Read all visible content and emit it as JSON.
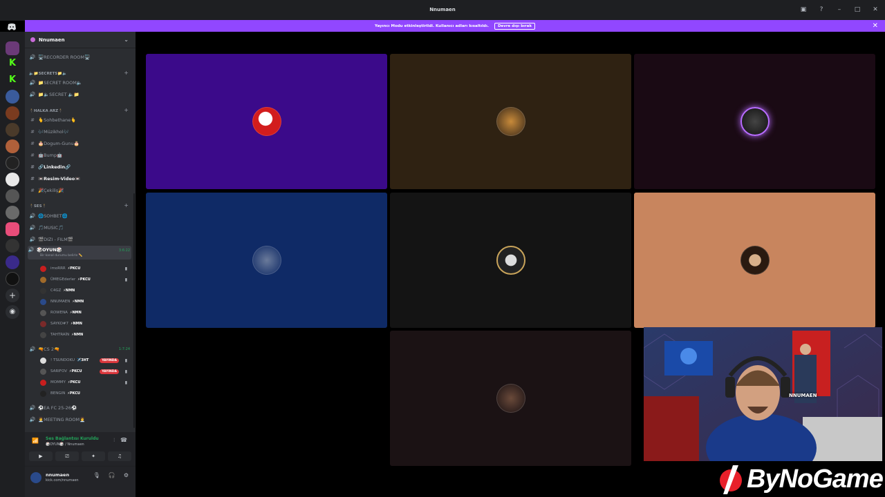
{
  "window": {
    "title": "Nnumaen"
  },
  "banner": {
    "text": "Yayıncı Modu etkinleştirildi. Kullanıcı adları kısaltıldı.",
    "button": "Devre dışı bırak"
  },
  "server": {
    "name": "Nnumaen"
  },
  "channels": {
    "recorder": "🖥️RECORDER ROOM🖥️",
    "cat_secrets": "🔈📁SECRETS📁🔈",
    "secret_room": "📁SECRET ROOM🔈",
    "secret": "📁🔈SECRET 🔈📁",
    "cat_halka": "🕴️HALKA ARZ🕴️",
    "sohbethane": "🫰Sohbethane🫰",
    "muzikhol": "🎶Müzikhol🎶",
    "dogum": "🎂Dogum-Gunu🎂",
    "bump": "🤖Bump🤖",
    "linkedin": "🔗Linkedin🔗",
    "resim": "📼Resim-Video📼",
    "cekilis": "🎉Çekiliş🎉",
    "cat_ses": "🕴️SES🕴️",
    "sohbet": "🌐SOHBET🌐",
    "music": "🎵MUSIC🎵",
    "dizi": "🎬DIZI - FILM🎬",
    "oyun": "🎲OYUN🎲",
    "oyun_timer": "3:6:22",
    "oyun_sub": "Bir kanal durumu belirle ✏️",
    "cs2": "🔫CS 2🔫",
    "cs2_timer": "1:7:24",
    "eafc": "⚽EA FC 25-26⚽",
    "meeting": "👩‍💼MEETING ROOM👩‍💼"
  },
  "oyun_users": [
    {
      "name": "imoRRR",
      "tag": "⚡PKCU"
    },
    {
      "name": "ÜMEGEderler",
      "tag": "⚡PKCU"
    },
    {
      "name": "C4GZ",
      "tag": "⚡NMN"
    },
    {
      "name": "NNUMAEN",
      "tag": "⚡NMN"
    },
    {
      "name": "ROWENA",
      "tag": "⚡NMN"
    },
    {
      "name": "SAYKO#7",
      "tag": "⚡NMN"
    },
    {
      "name": "TAHTRAİN",
      "tag": "⚡NMN"
    }
  ],
  "cs2_users": [
    {
      "name": "! TSUNDOKU",
      "tag": "✈️3HT",
      "live": "YAYINDA"
    },
    {
      "name": "SARIFOV",
      "tag": "⚡PKCU",
      "live": "YAYINDA"
    },
    {
      "name": "MOMMY",
      "tag": "⚡PKCU"
    },
    {
      "name": "BENGIN",
      "tag": "⚡PKCU"
    }
  ],
  "voice": {
    "status": "Ses Bağlantısı Kuruldu",
    "channel": "🎲OYUN🎲 / Nnumaen"
  },
  "user": {
    "name": "nnumaen",
    "status": "kick.com/nnumaen"
  },
  "webcam": {
    "label": "NNUMAEN"
  },
  "watermark": {
    "text": "ByNoGame"
  },
  "colors": {
    "accent": "#9147ff",
    "tile1": "#3b0a8a",
    "tile2": "#2f2212",
    "tile3": "#1a0a14",
    "tile4": "#0f2a66",
    "tile5": "#141414",
    "tile6": "#c8855e",
    "tile7": "#1b1214"
  }
}
